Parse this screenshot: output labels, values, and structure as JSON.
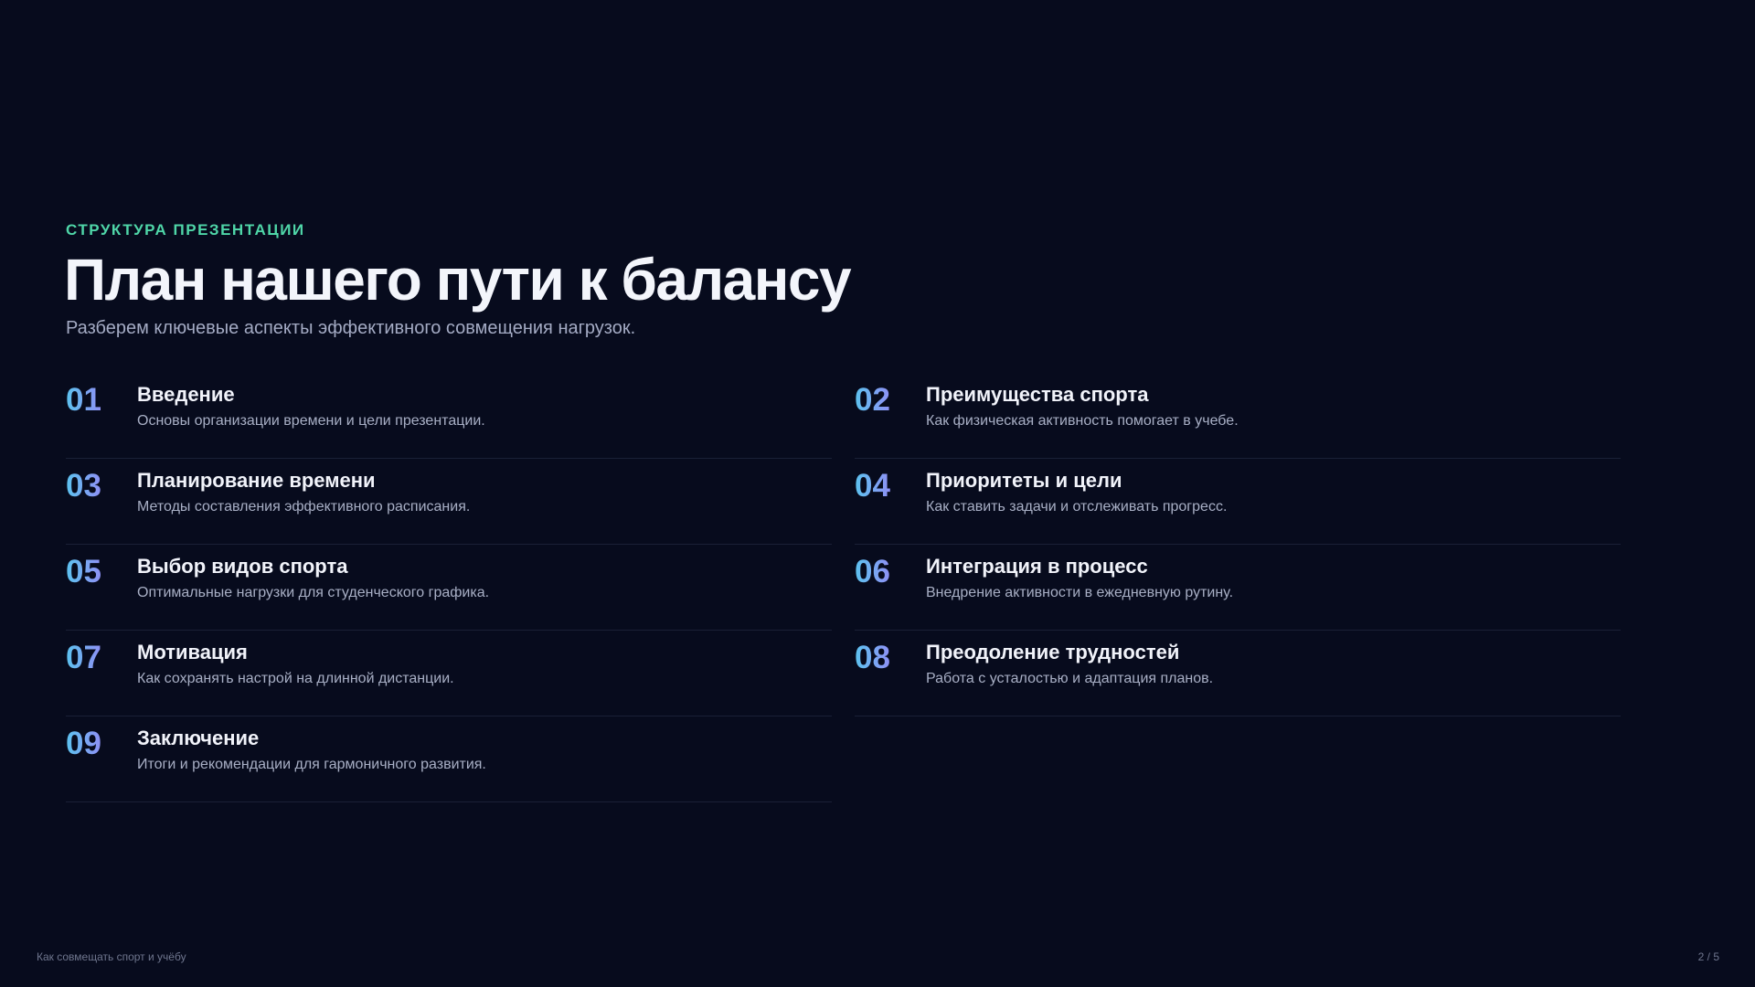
{
  "header": {
    "eyebrow": "СТРУКТУРА ПРЕЗЕНТАЦИИ",
    "title": "План нашего пути к балансу",
    "subtitle": "Разберем ключевые аспекты эффективного совмещения нагрузок."
  },
  "items": [
    {
      "number": "01",
      "title": "Введение",
      "description": "Основы организации времени и цели презентации."
    },
    {
      "number": "02",
      "title": "Преимущества спорта",
      "description": "Как физическая активность помогает в учебе."
    },
    {
      "number": "03",
      "title": "Планирование времени",
      "description": "Методы составления эффективного расписания."
    },
    {
      "number": "04",
      "title": "Приоритеты и цели",
      "description": "Как ставить задачи и отслеживать прогресс."
    },
    {
      "number": "05",
      "title": "Выбор видов спорта",
      "description": "Оптимальные нагрузки для студенческого графика."
    },
    {
      "number": "06",
      "title": "Интеграция в процесс",
      "description": "Внедрение активности в ежедневную рутину."
    },
    {
      "number": "07",
      "title": "Мотивация",
      "description": "Как сохранять настрой на длинной дистанции."
    },
    {
      "number": "08",
      "title": "Преодоление трудностей",
      "description": "Работа с усталостью и адаптация планов."
    },
    {
      "number": "09",
      "title": "Заключение",
      "description": "Итоги и рекомендации для гармоничного развития."
    }
  ],
  "footer": {
    "presentation_title": "Как совмещать спорт и учёбу",
    "page_indicator": "2 / 5"
  },
  "colors": {
    "background": "#070b1d",
    "accent_eyebrow": "#4fd6a8",
    "number_gradient_start": "#5cc3ef",
    "number_gradient_end": "#8f90f5"
  }
}
